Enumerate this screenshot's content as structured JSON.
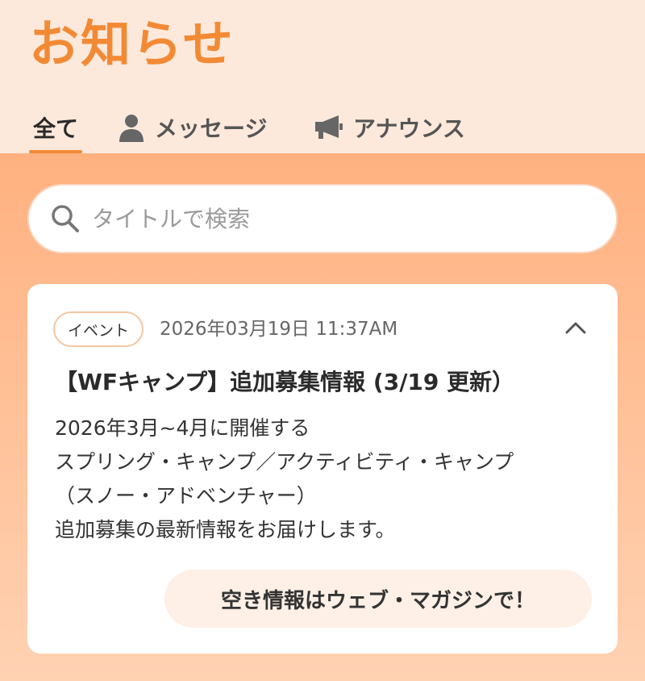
{
  "header": {
    "title": "お知らせ"
  },
  "tabs": [
    {
      "label": "全て",
      "icon": "",
      "active": true
    },
    {
      "label": "メッセージ",
      "icon": "person-icon",
      "active": false
    },
    {
      "label": "アナウンス",
      "icon": "megaphone-icon",
      "active": false
    }
  ],
  "search": {
    "placeholder": "タイトルで検索",
    "value": "",
    "icon": "search-icon"
  },
  "notification": {
    "category": "イベント",
    "timestamp": "2026年03月19日 11:37AM",
    "expanded": true,
    "title": "【WFキャンプ】追加募集情報 (3/19 更新）",
    "body_lines": [
      "2026年3月~4月に開催する",
      "スプリング・キャンプ／アクティビティ・キャンプ",
      "（スノー・アドベンチャー）",
      "追加募集の最新情報をお届けします。"
    ],
    "cta_label": "空き情報はウェブ・マガジンで！"
  },
  "colors": {
    "accent": "#f28a35",
    "header_bg": "#fde9dc",
    "content_bg": "#ffb180"
  }
}
